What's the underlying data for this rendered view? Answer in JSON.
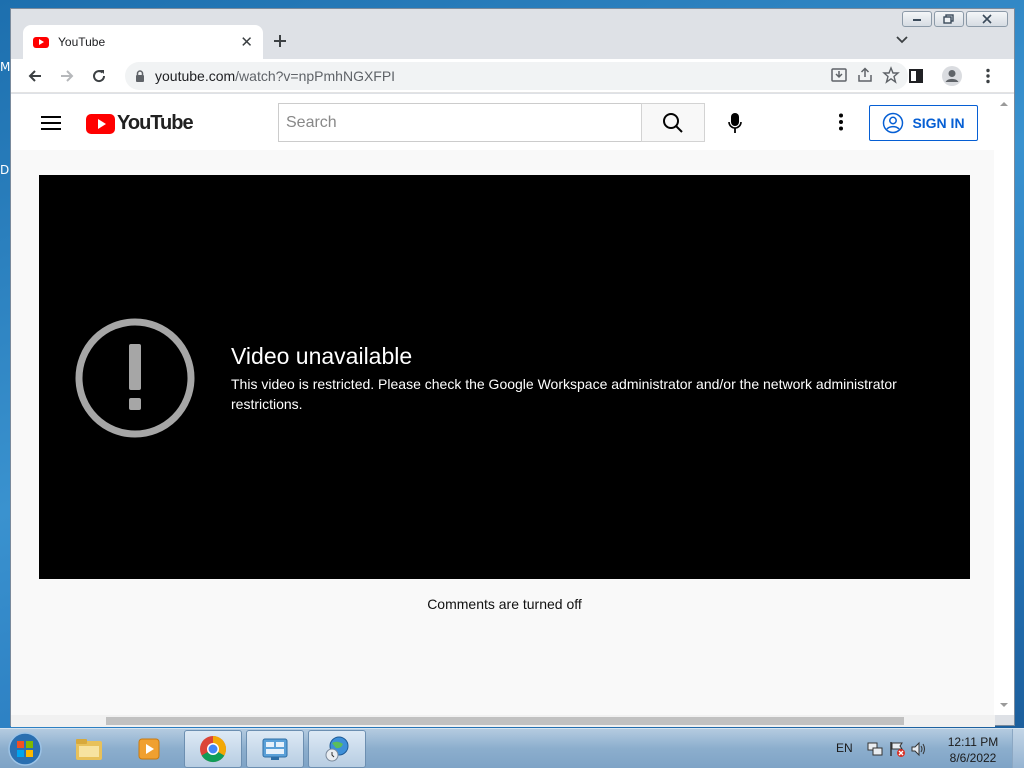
{
  "desktop": {
    "edge_labels": [
      "M",
      "D"
    ]
  },
  "browser": {
    "tab": {
      "title": "YouTube"
    },
    "omnibox": {
      "url_host": "youtube.com",
      "url_path": "/watch?v=npPmhNGXFPI"
    }
  },
  "youtube": {
    "logo_text": "YouTube",
    "search": {
      "placeholder": "Search"
    },
    "signin_label": "SIGN IN",
    "player": {
      "error_title": "Video unavailable",
      "error_message": "This video is restricted. Please check the Google Workspace administrator and/or the network administrator restrictions."
    },
    "comments_status": "Comments are turned off"
  },
  "taskbar": {
    "language": "EN",
    "time": "12:11 PM",
    "date": "8/6/2022"
  },
  "colors": {
    "youtube_red": "#ff0000",
    "signin_blue": "#065fd4",
    "player_bg": "#000000"
  }
}
